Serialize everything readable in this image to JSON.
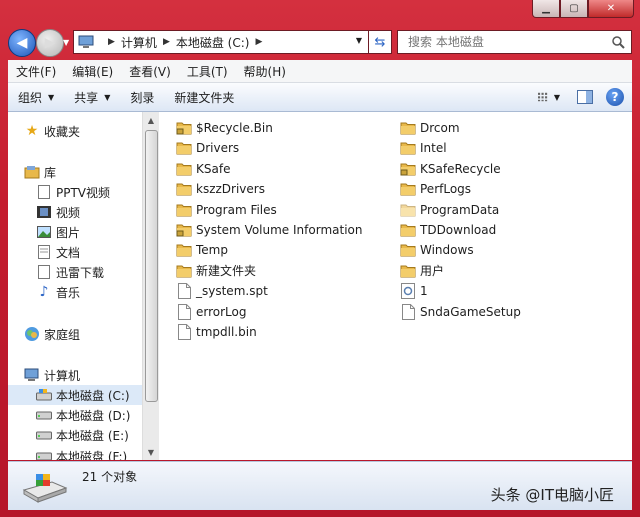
{
  "caption": {
    "min": "▁",
    "max": "▢",
    "close": "✕"
  },
  "address": {
    "crumbs": [
      "计算机",
      "本地磁盘 (C:)"
    ]
  },
  "search": {
    "placeholder": "搜索 本地磁盘"
  },
  "menu": [
    "文件(F)",
    "编辑(E)",
    "查看(V)",
    "工具(T)",
    "帮助(H)"
  ],
  "toolbar": {
    "organize": "组织",
    "share": "共享",
    "burn": "刻录",
    "new_folder": "新建文件夹"
  },
  "nav": {
    "favorites": "收藏夹",
    "libraries": "库",
    "lib_items": [
      "PPTV视频",
      "视频",
      "图片",
      "文档",
      "迅雷下载",
      "音乐"
    ],
    "homegroup": "家庭组",
    "computer": "计算机",
    "drives": [
      "本地磁盘 (C:)",
      "本地磁盘 (D:)",
      "本地磁盘 (E:)",
      "本地磁盘 (F:)"
    ]
  },
  "files": {
    "left": [
      {
        "name": "$Recycle.Bin",
        "icon": "folder-locked"
      },
      {
        "name": "Drivers",
        "icon": "folder"
      },
      {
        "name": "KSafe",
        "icon": "folder"
      },
      {
        "name": "kszzDrivers",
        "icon": "folder"
      },
      {
        "name": "Program Files",
        "icon": "folder"
      },
      {
        "name": "System Volume Information",
        "icon": "folder-locked"
      },
      {
        "name": "Temp",
        "icon": "folder"
      },
      {
        "name": "新建文件夹",
        "icon": "folder"
      },
      {
        "name": "_system.spt",
        "icon": "file"
      },
      {
        "name": "errorLog",
        "icon": "file"
      },
      {
        "name": "tmpdll.bin",
        "icon": "file"
      }
    ],
    "right": [
      {
        "name": "Drcom",
        "icon": "folder"
      },
      {
        "name": "Intel",
        "icon": "folder"
      },
      {
        "name": "KSafeRecycle",
        "icon": "folder-locked"
      },
      {
        "name": "PerfLogs",
        "icon": "folder"
      },
      {
        "name": "ProgramData",
        "icon": "folder-hidden"
      },
      {
        "name": "TDDownload",
        "icon": "folder"
      },
      {
        "name": "Windows",
        "icon": "folder"
      },
      {
        "name": "用户",
        "icon": "folder"
      },
      {
        "name": "1",
        "icon": "config-file"
      },
      {
        "name": "SndaGameSetup",
        "icon": "file"
      }
    ]
  },
  "status": {
    "count": "21 个对象"
  },
  "watermark": "头条 @IT电脑小匠",
  "colors": {
    "window_frame": "#c41c2e",
    "folder": "#e8b84a",
    "selection": "#dce9f8"
  }
}
